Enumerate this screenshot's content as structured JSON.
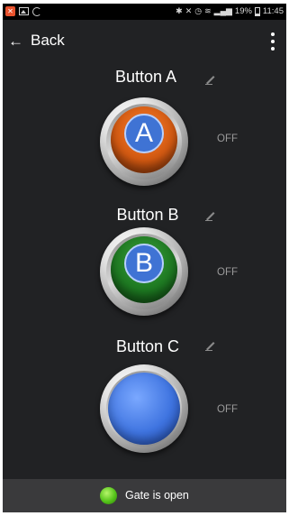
{
  "status_bar": {
    "right_text": "19%",
    "time": "11:45",
    "icons": [
      "app-notification-icon",
      "image-icon",
      "sync-icon",
      "bluetooth-icon",
      "mute-icon",
      "alarm-icon",
      "wifi-icon",
      "signal-icon",
      "battery-icon"
    ]
  },
  "app_bar": {
    "back_label": "Back",
    "back_icon": "arrow-left-icon",
    "menu_icon": "overflow-menu-icon"
  },
  "buttons": [
    {
      "label": "Button A",
      "letter": "A",
      "state": "OFF",
      "cap_color": "#d45a12"
    },
    {
      "label": "Button B",
      "letter": "B",
      "state": "OFF",
      "cap_color": "#1e7a22"
    },
    {
      "label": "Button C",
      "state": "OFF",
      "cap_color": "#3f74e0"
    }
  ],
  "footer": {
    "status_text": "Gate is open",
    "indicator_color": "#55c41a"
  },
  "colors": {
    "background": "#212224",
    "footer": "#3a3a3c",
    "text": "#ffffff",
    "state_text": "#9a9a9a"
  }
}
